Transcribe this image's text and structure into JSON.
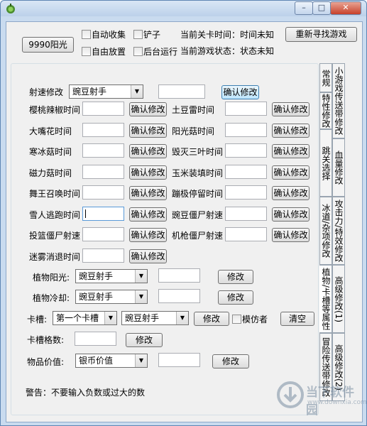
{
  "window": {
    "title": ""
  },
  "top": {
    "sun_button": "9990阳光",
    "auto_collect": "自动收集",
    "shovel": "铲子",
    "free_place": "自由放置",
    "background_run": "后台运行",
    "level_time": "当前关卡时间：时间未知",
    "game_state": "当前游戏状态：状态未知",
    "refind_button": "重新寻找游戏"
  },
  "speed": {
    "label": "射速修改",
    "plant": "豌豆射手",
    "value": "",
    "confirm": "确认修改"
  },
  "timers": [
    {
      "label": "樱桃辣椒时间",
      "value": "",
      "button": "确认修改"
    },
    {
      "label": "土豆雷时间",
      "value": "",
      "button": "确认修改"
    },
    {
      "label": "大嘴花时间",
      "value": "",
      "button": "确认修改"
    },
    {
      "label": "阳光菇时间",
      "value": "",
      "button": "确认修改"
    },
    {
      "label": "寒冰菇时间",
      "value": "",
      "button": "确认修改"
    },
    {
      "label": "毁灭三叶时间",
      "value": "",
      "button": "确认修改"
    },
    {
      "label": "磁力菇时间",
      "value": "",
      "button": "确认修改"
    },
    {
      "label": "玉米装填时间",
      "value": "",
      "button": "确认修改"
    },
    {
      "label": "舞王召唤时间",
      "value": "",
      "button": "确认修改"
    },
    {
      "label": "蹦极停留时间",
      "value": "",
      "button": "确认修改"
    },
    {
      "label": "雪人逃跑时间",
      "value": "",
      "button": "确认修改"
    },
    {
      "label": "豌豆僵尸射速",
      "value": "",
      "button": "确认修改"
    },
    {
      "label": "投篮僵尸射速",
      "value": "",
      "button": "确认修改"
    },
    {
      "label": "机枪僵尸射速",
      "value": "",
      "button": "确认修改"
    },
    {
      "label": "迷雾消退时间",
      "value": "",
      "button": "确认修改"
    }
  ],
  "plant_sun": {
    "label": "植物阳光:",
    "plant": "豌豆射手",
    "value": "",
    "button": "修改"
  },
  "plant_cd": {
    "label": "植物冷却:",
    "plant": "豌豆射手",
    "value": "",
    "button": "修改"
  },
  "card_slot": {
    "label": "卡槽:",
    "slot": "第一个卡槽",
    "plant": "豌豆射手",
    "button": "修改",
    "imitator": "模仿者",
    "clear": "清空"
  },
  "slot_count": {
    "label": "卡槽格数:",
    "value": "",
    "button": "修改"
  },
  "item_value": {
    "label": "物品价值:",
    "item": "银币价值",
    "value": "",
    "button": "修改"
  },
  "warning": "警告：不要输入负数或过大的数",
  "tabs": {
    "regular": "常规",
    "minigame": "小游戏传送带修改",
    "special": "特性修改",
    "jump": "跳关选择",
    "hp": "血量修改",
    "cannon": "冰道/杂项修改",
    "attack": "攻击力/特效修改",
    "plant_card": "植物/卡槽等属性",
    "advanced1": "高级修改(1)",
    "advanced2": "高级修改(2)",
    "adventure": "冒险传送带修改"
  },
  "watermark": {
    "brand": "当下软件园",
    "url": "www.downxia.com"
  }
}
